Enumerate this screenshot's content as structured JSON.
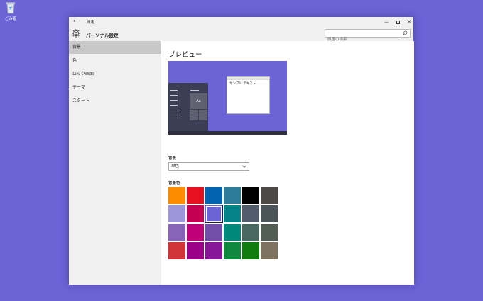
{
  "desktop": {
    "recycle_bin_label": "ごみ箱"
  },
  "window": {
    "title": "設定",
    "back_glyph": "←",
    "min_glyph": "—",
    "close_glyph": "✕"
  },
  "header": {
    "page_title": "パーソナル設定",
    "search_placeholder": "設定の検索"
  },
  "sidebar": {
    "items": [
      {
        "label": "背景",
        "selected": true
      },
      {
        "label": "色",
        "selected": false
      },
      {
        "label": "ロック画面",
        "selected": false
      },
      {
        "label": "テーマ",
        "selected": false
      },
      {
        "label": "スタート",
        "selected": false
      }
    ]
  },
  "main": {
    "preview_heading": "プレビュー",
    "preview_tile_text": "Aa",
    "preview_window_text": "サンプル テキスト",
    "background_label": "背景",
    "background_value": "単色",
    "bg_color_label": "背景色",
    "swatches": [
      "#ff8c00",
      "#e81123",
      "#0063b1",
      "#2d7d9a",
      "#000000",
      "#4c4a48",
      "#9c96d8",
      "#c30052",
      "#6b63d6",
      "#038387",
      "#515c6b",
      "#4a5459",
      "#8764b8",
      "#bf0077",
      "#744da9",
      "#00897b",
      "#486860",
      "#525e54",
      "#d13438",
      "#9a0089",
      "#881798",
      "#10893e",
      "#107c10",
      "#7e735f"
    ],
    "selected_swatch": "#6b63d6"
  }
}
